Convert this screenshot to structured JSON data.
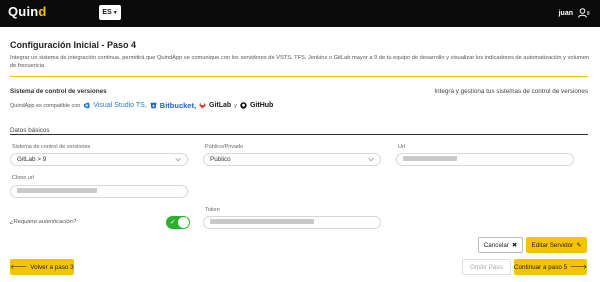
{
  "header": {
    "logo_main": "Quin",
    "logo_accent": "d",
    "language": "ES",
    "user_name": "juan",
    "user_icon": "user-menu-icon"
  },
  "page": {
    "title": "Configuración Inicial - Paso 4",
    "description": "Integrar un sistema de integración continua, permitirá que QuindApp se comunique con los servidores de VSTS, TFS, Jenkins o GitLab mayor a 9 de tu equipo de desarrollo y visualizar los indicadores de automatización y volumen de frecuencia",
    "accent_color": "#f5c400"
  },
  "vcs": {
    "section_title": "Sistema de control de versiones",
    "right_text": "Integra y gestiona tus sistemas de control de versiones",
    "compat_text": "QuindApp es compatible con",
    "tools": {
      "visual_studio": "Visual Studio TS,",
      "bitbucket": "Bitbucket,",
      "gitlab": "GitLab",
      "and": "y",
      "github": "GitHub"
    }
  },
  "datos": {
    "section_title": "Datos básicos",
    "vcs_system_label": "Sistema de control de versiones",
    "vcs_system_value": "GitLab > 9",
    "visibility_label": "Público/Privado",
    "visibility_value": "Público",
    "url_label": "Url",
    "clone_url_label": "Clone url",
    "auth_question": "¿Requiere autenticación?",
    "auth_enabled": true,
    "token_label": "Token"
  },
  "actions": {
    "cancel_label": "Cancelar",
    "edit_server_label": "Editar Servidor",
    "back_label": "Volver a paso 3",
    "skip_label": "Omitir Paso",
    "continue_label": "Continuar a paso 5"
  }
}
